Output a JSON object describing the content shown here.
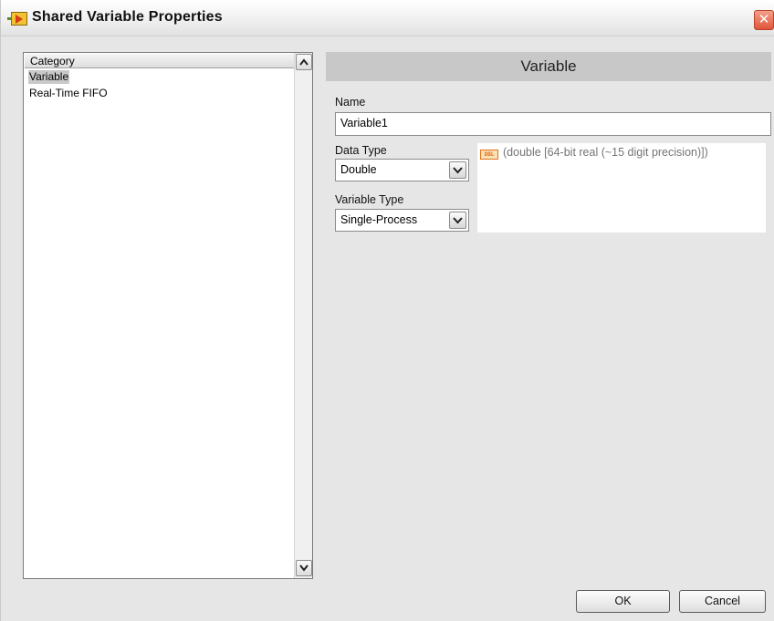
{
  "window": {
    "title": "Shared Variable Properties"
  },
  "category": {
    "header": "Category",
    "items": [
      {
        "label": "Variable",
        "selected": true
      },
      {
        "label": "Real-Time FIFO",
        "selected": false
      }
    ]
  },
  "section": {
    "title": "Variable"
  },
  "name": {
    "label": "Name",
    "value": "Variable1"
  },
  "data_type": {
    "label": "Data Type",
    "value": "Double",
    "icon_text": "DBL",
    "description": "(double [64-bit real (~15 digit precision)])"
  },
  "variable_type": {
    "label": "Variable Type",
    "value": "Single-Process"
  },
  "buttons": {
    "ok": "OK",
    "cancel": "Cancel"
  }
}
